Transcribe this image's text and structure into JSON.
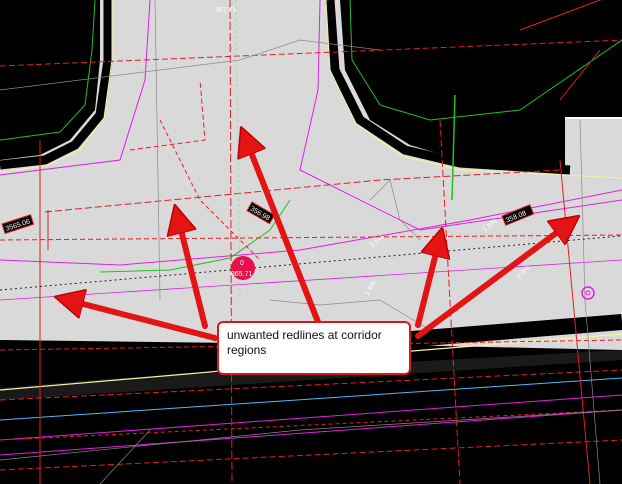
{
  "callout": {
    "text": "unwanted redlines at corridor regions"
  },
  "labels": {
    "elev_center_top": "0",
    "elev_center_bottom": "365.71",
    "elev_top": "357.71",
    "tag_left": "3565.06",
    "tag_center": "356.98",
    "tag_right": "358.08",
    "slope_1": "2.5%",
    "slope_2": "1.5%",
    "slope_3": "1.6%",
    "slope_4": "2.0%"
  },
  "colors": {
    "background": "#000000",
    "pavement": "#d9d9d9",
    "curb": "#000000",
    "redline": "#e0202a",
    "magenta": "#e020e0",
    "green": "#20c020",
    "arrow": "#e41414",
    "point": "#e8104a"
  },
  "icons": {
    "arrow": "red-arrow-icon",
    "target": "circle-target-icon"
  }
}
